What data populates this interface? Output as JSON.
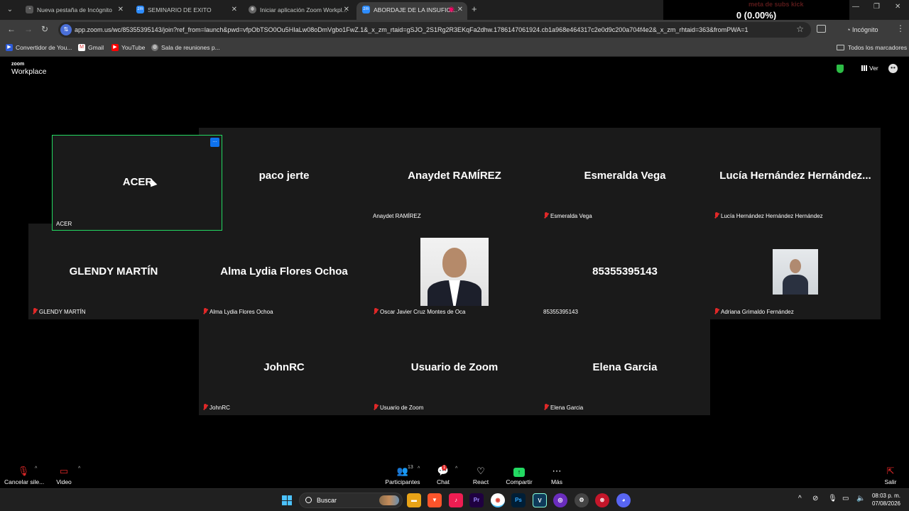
{
  "browser": {
    "tabs": [
      {
        "title": "Nueva pestaña de Incógnito"
      },
      {
        "title": "SEMINARIO DE EXITO"
      },
      {
        "title": "Iniciar aplicación Zoom Workpl..."
      },
      {
        "title": "ABORDAJE DE LA INSUFICI..."
      }
    ],
    "url": "app.zoom.us/wc/85355395143/join?ref_from=launch&pwd=vfpObTSO0Ou5HIaLw08oDmVgbo1FwZ.1&_x_zm_rtaid=gSJO_2S1Rg2R3EKqFa2dhw.1786147061924.cb1a968e464317c2e0d9c200a704f4e2&_x_zm_rhtaid=363&fromPWA=1",
    "incognito_label": "Incógnito",
    "bookmarks": [
      "Convertidor de You...",
      "Gmail",
      "YouTube",
      "Sala de reuniones p..."
    ],
    "all_bookmarks_label": "Todos los marcadores"
  },
  "overlay": {
    "title": "meta de subs kick",
    "count": "0 (0.00%)"
  },
  "zoom_header": {
    "logo_top": "zoom",
    "logo_bottom": "Workplace",
    "view_label": "Ver"
  },
  "participants": [
    {
      "display": "ACER",
      "label": "ACER",
      "muted": false
    },
    {
      "display": "paco jerte",
      "label": "jerte",
      "muted": false
    },
    {
      "display": "Anaydet RAMÍREZ",
      "label": "Anaydet RAMÍREZ",
      "muted": false
    },
    {
      "display": "Esmeralda Vega",
      "label": "Esmeralda Vega",
      "muted": true
    },
    {
      "display": "Lucía Hernández Hernández...",
      "label": "Lucía Hernández Hernández Hernández",
      "muted": true
    },
    {
      "display": "GLENDY MARTÍN",
      "label": "GLENDY MARTÍN",
      "muted": true
    },
    {
      "display": "Alma Lydia Flores Ochoa",
      "label": "Alma Lydia Flores Ochoa",
      "muted": true
    },
    {
      "display": "",
      "label": "Oscar Javier Cruz Montes de Oca",
      "muted": true
    },
    {
      "display": "85355395143",
      "label": "85355395143",
      "muted": false
    },
    {
      "display": "",
      "label": "Adriana Grimaldo Fernández",
      "muted": true
    },
    {
      "display": "JohnRC",
      "label": "JohnRC",
      "muted": true
    },
    {
      "display": "Usuario de Zoom",
      "label": "Usuario de Zoom",
      "muted": true
    },
    {
      "display": "Elena Garcia",
      "label": "Elena Garcia",
      "muted": true
    }
  ],
  "toolbar": {
    "mute_label": "Cancelar sile...",
    "video_label": "Video",
    "participants_label": "Participantes",
    "participants_count": "13",
    "chat_label": "Chat",
    "chat_badge": "1",
    "react_label": "React",
    "share_label": "Compartir",
    "more_label": "Más",
    "leave_label": "Salir"
  },
  "taskbar": {
    "search_label": "Buscar",
    "time": "08:03 p. m.",
    "date": "07/08/2026"
  },
  "colors": {
    "active_speaker_border": "#23d962",
    "muted_icon": "#e02828",
    "share_green": "#23d962",
    "tile_bg": "#1a1a1a"
  }
}
